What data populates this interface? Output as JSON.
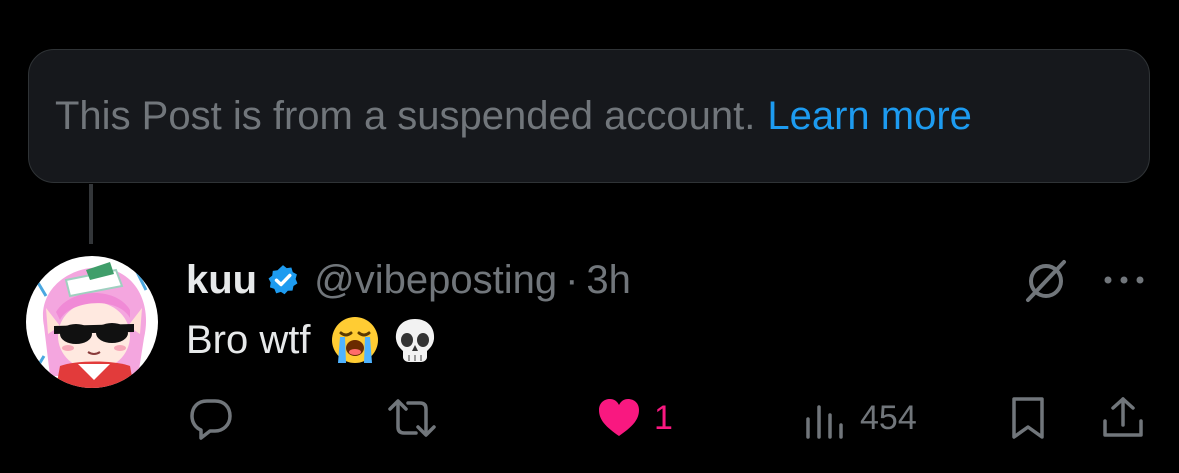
{
  "notice": {
    "text": "This Post is from a suspended account.",
    "link": "Learn more"
  },
  "post": {
    "display_name": "kuu",
    "verified": true,
    "handle": "@vibeposting",
    "separator": "·",
    "timestamp": "3h",
    "text": "Bro wtf",
    "emojis": [
      "loudly-crying-face",
      "skull"
    ]
  },
  "actions": {
    "reply_icon": "reply-icon",
    "repost_icon": "repost-icon",
    "like_icon": "heart-icon",
    "like_count": "1",
    "liked": true,
    "views_icon": "views-icon",
    "views_count": "454",
    "bookmark_icon": "bookmark-icon",
    "share_icon": "share-icon",
    "grok_icon": "grok-icon",
    "more_icon": "more-icon"
  },
  "colors": {
    "background": "#000000",
    "card_background": "#16181c",
    "card_border": "#2f3336",
    "primary_text": "#e7e9ea",
    "secondary_text": "#71767b",
    "link": "#1d9bf0",
    "like": "#f91880",
    "verified_badge": "#1d9bf0"
  }
}
